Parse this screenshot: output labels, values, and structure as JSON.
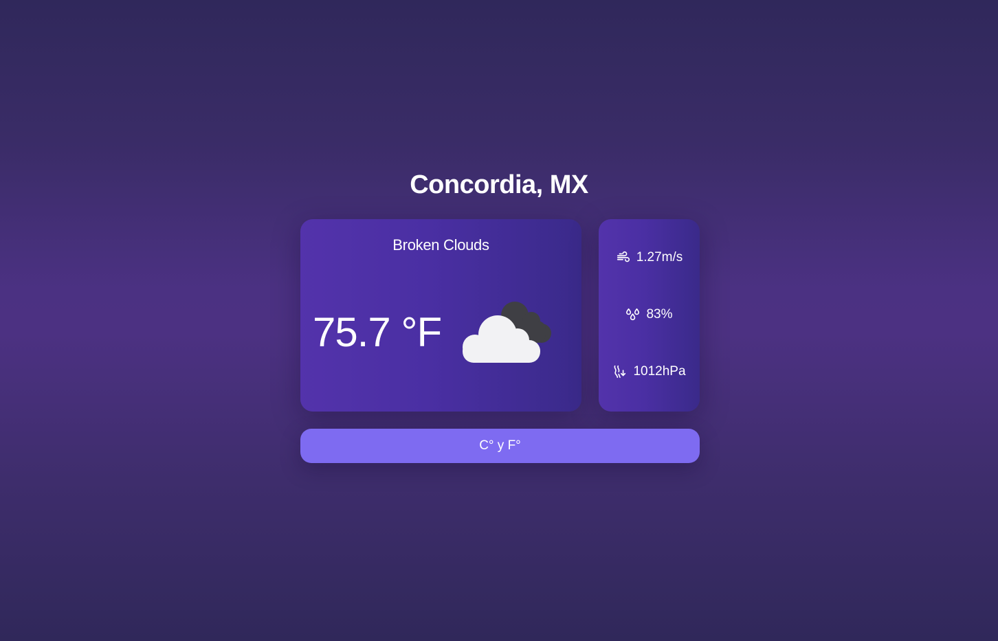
{
  "location": {
    "city": "Concordia, MX"
  },
  "current": {
    "description": "Broken Clouds",
    "temperature": "75.7 °F",
    "icon": "broken-clouds-icon"
  },
  "stats": {
    "wind": {
      "icon": "wind-icon",
      "value": "1.27m/s"
    },
    "humidity": {
      "icon": "humidity-icon",
      "value": "83%"
    },
    "pressure": {
      "icon": "pressure-icon",
      "value": "1012hPa"
    }
  },
  "controls": {
    "unit_toggle_label": "C° y F°"
  },
  "colors": {
    "background_top": "#30285b",
    "background_mid": "#4b3182",
    "card_start": "#5333ab",
    "card_end": "#3a2a8a",
    "button": "#7e6bf1",
    "text": "#ffffff"
  }
}
